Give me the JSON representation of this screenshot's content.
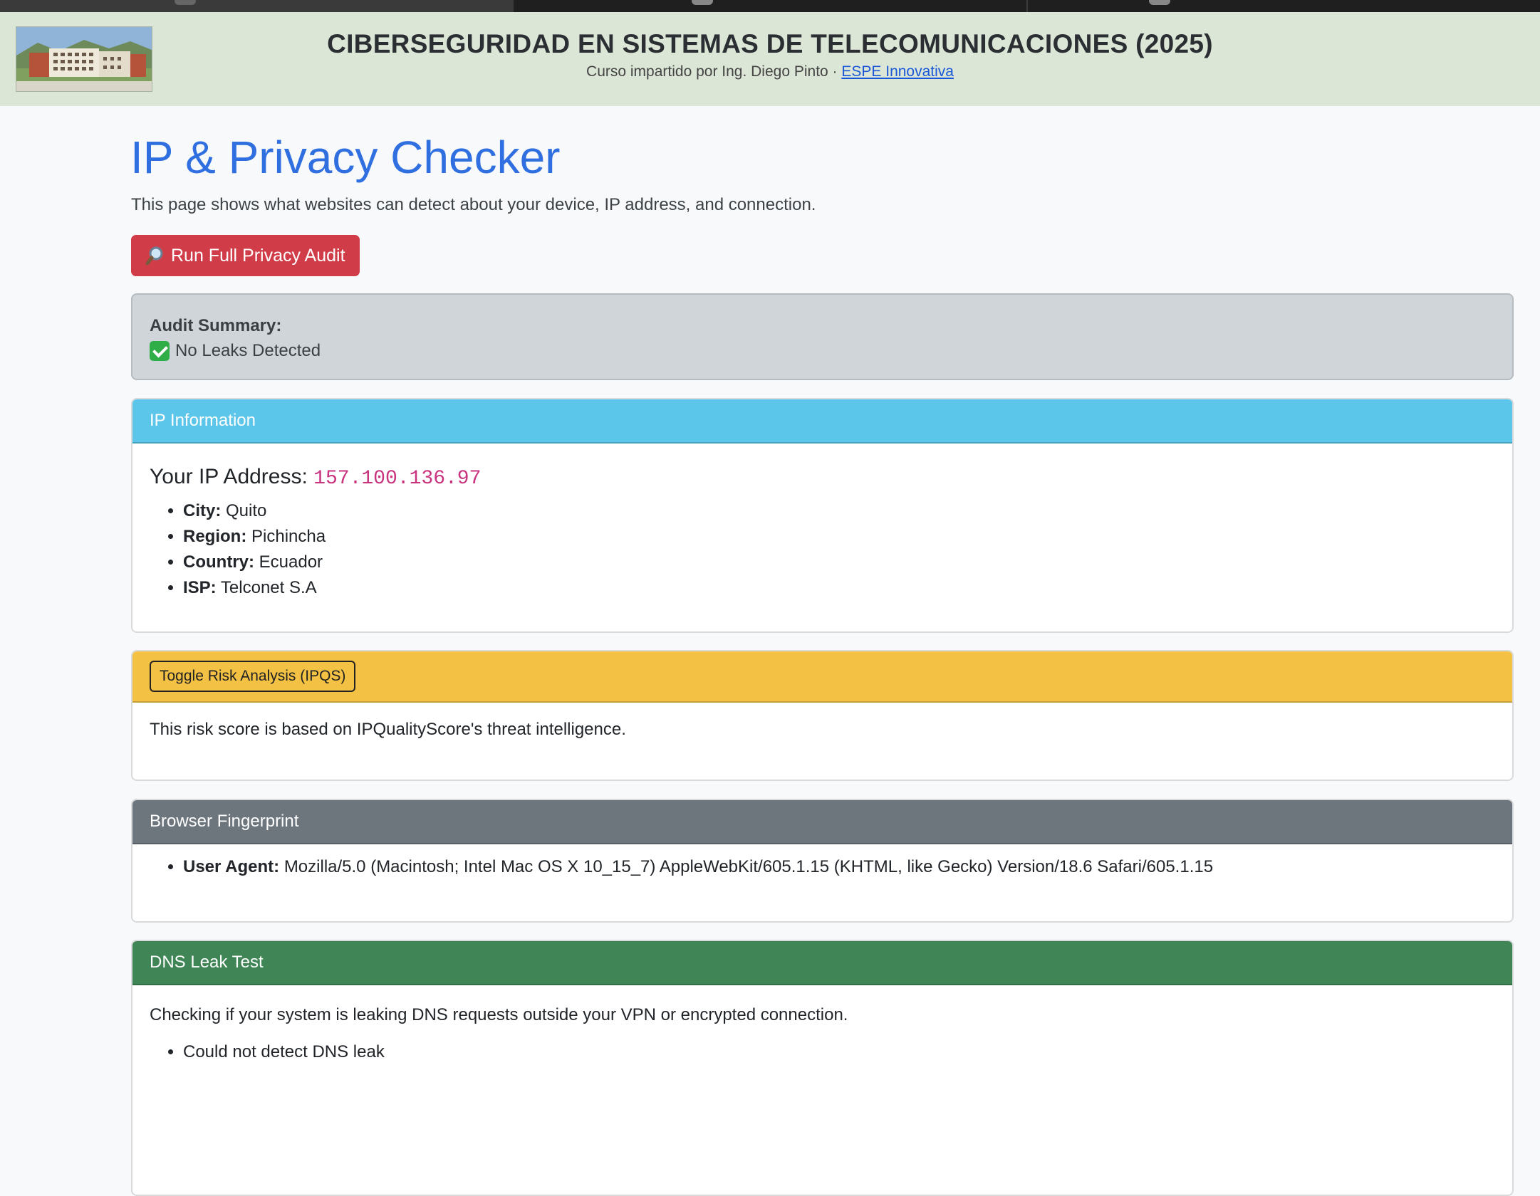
{
  "header": {
    "title": "CIBERSEGURIDAD EN SISTEMAS DE TELECOMUNICACIONES (2025)",
    "subtitle_prefix": "Curso impartido por Ing. Diego Pinto · ",
    "subtitle_link": "ESPE Innovativa"
  },
  "page": {
    "title": "IP & Privacy Checker",
    "lead": "This page shows what websites can detect about your device, IP address, and connection.",
    "audit_button": "Run Full Privacy Audit"
  },
  "summary": {
    "label": "Audit Summary:",
    "status": "No Leaks Detected"
  },
  "ip_card": {
    "header": "IP Information",
    "ip_label": "Your IP Address:",
    "ip_value": "157.100.136.97",
    "details": [
      {
        "key": "City:",
        "value": "Quito"
      },
      {
        "key": "Region:",
        "value": "Pichincha"
      },
      {
        "key": "Country:",
        "value": "Ecuador"
      },
      {
        "key": "ISP:",
        "value": "Telconet S.A"
      }
    ]
  },
  "risk_card": {
    "toggle_label": "Toggle Risk Analysis (IPQS)",
    "body": "This risk score is based on IPQualityScore's threat intelligence."
  },
  "fingerprint_card": {
    "header": "Browser Fingerprint",
    "ua_key": "User Agent:",
    "ua_value": "Mozilla/5.0 (Macintosh; Intel Mac OS X 10_15_7) AppleWebKit/605.1.15 (KHTML, like Gecko) Version/18.6 Safari/605.1.15"
  },
  "dns_card": {
    "header": "DNS Leak Test",
    "body": "Checking if your system is leaking DNS requests outside your VPN or encrypted connection.",
    "result": "Could not detect DNS leak"
  },
  "colors": {
    "title_blue": "#2f6fe0",
    "audit_red": "#d03c48",
    "info_header": "#5bc6ea",
    "warning_header": "#f3c244",
    "secondary_header": "#6d757d",
    "success_header": "#3f8556",
    "ip_value": "#c9337e",
    "header_bg": "#dce6d6"
  },
  "icons": {
    "audit_button": "magnifying-glass-icon",
    "summary_status": "check-mark-icon",
    "logo": "university-building-logo"
  }
}
